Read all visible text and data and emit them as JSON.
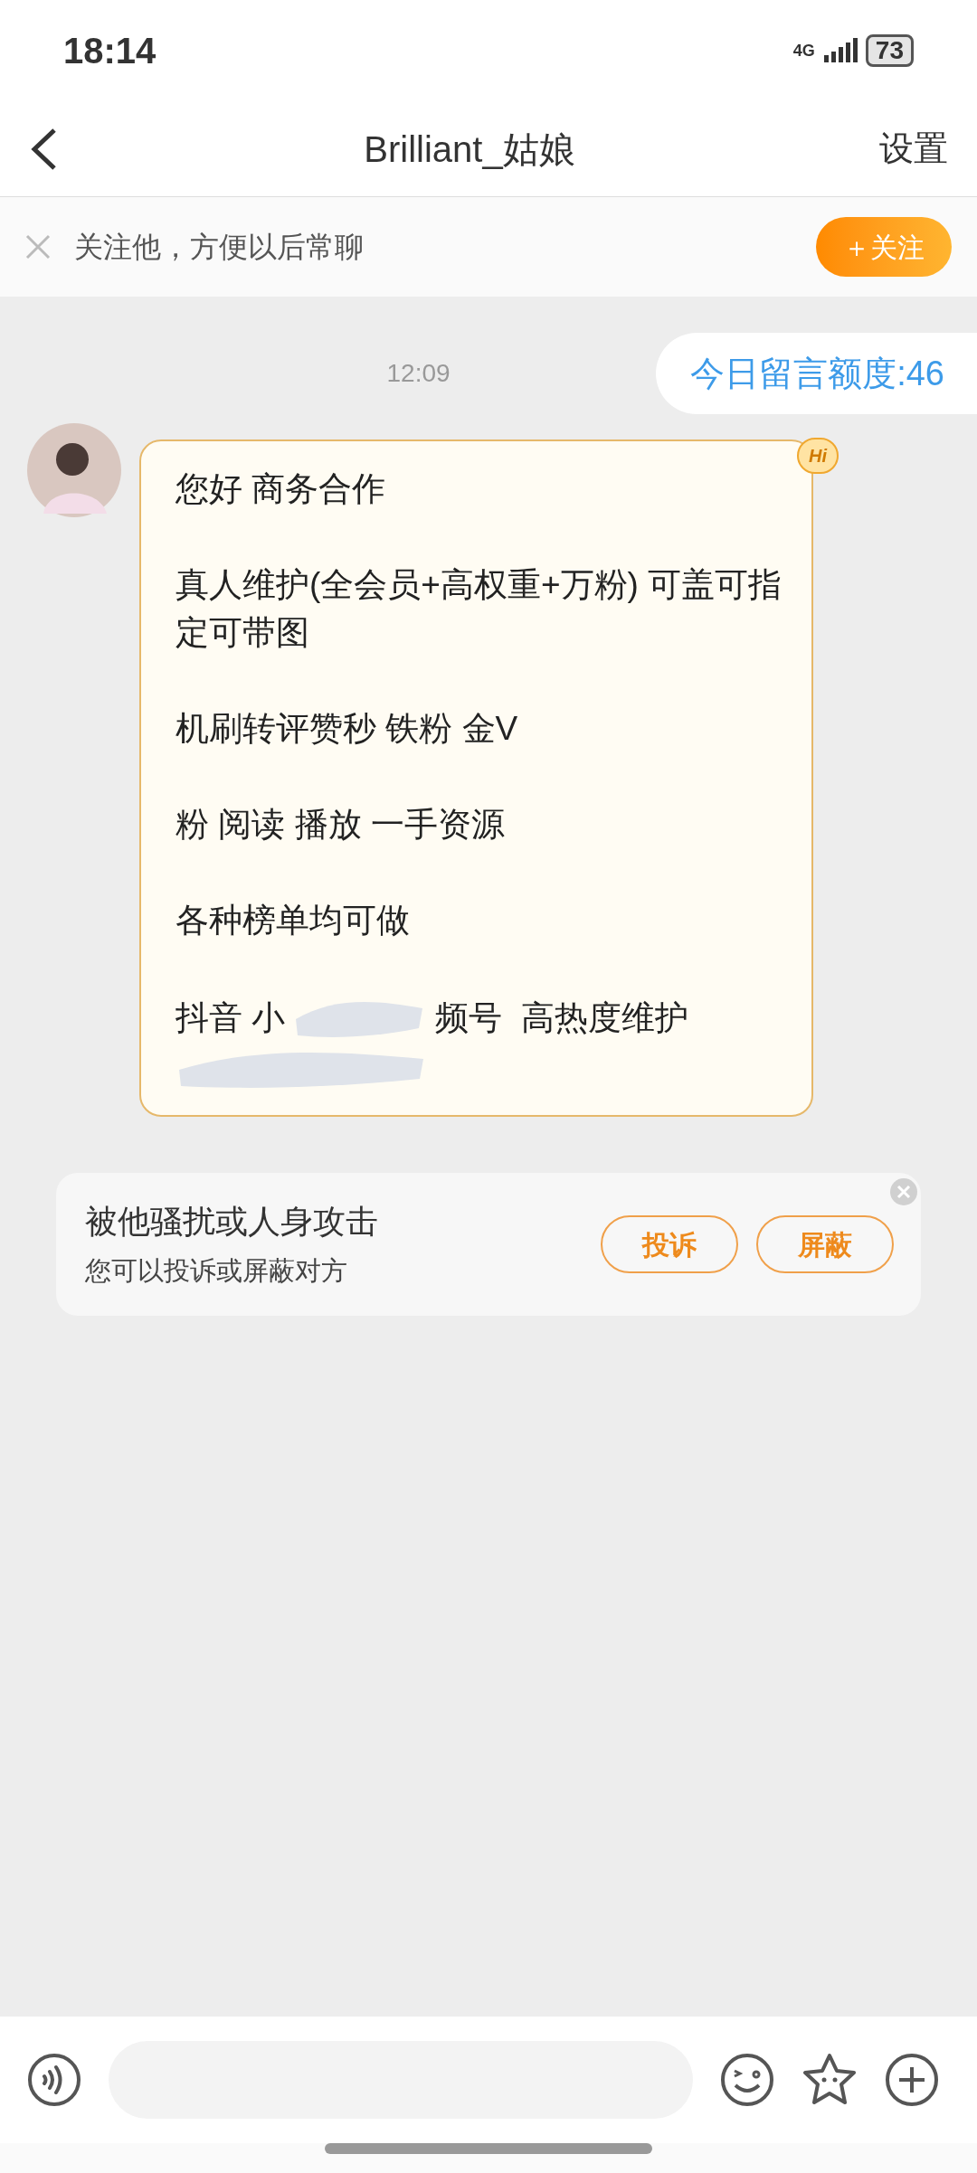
{
  "status_bar": {
    "time": "18:14",
    "network": "4G",
    "battery": "73"
  },
  "header": {
    "title": "Brilliant_姑娘",
    "action": "设置"
  },
  "follow_bar": {
    "text": "关注他，方便以后常聊",
    "button": "＋关注"
  },
  "chat": {
    "timestamp": "12:09",
    "quota": "今日留言额度:46",
    "message": {
      "badge": "Hi",
      "paragraphs": [
        {
          "kind": "text",
          "text": "您好 商务合作"
        },
        {
          "kind": "text",
          "text": "真人维护(全会员+高权重+万粉) 可盖可指定可带图"
        },
        {
          "kind": "text",
          "text": "机刷转评赞秒 铁粉 金V"
        },
        {
          "kind": "text",
          "text": "粉 阅读 播放 一手资源"
        },
        {
          "kind": "text",
          "text": "各种榜单均可做"
        },
        {
          "kind": "redacted",
          "before": "抖音 小",
          "after": "频号  高热度维护"
        }
      ]
    }
  },
  "safety_card": {
    "title": "被他骚扰或人身攻击",
    "subtitle": "您可以投诉或屏蔽对方",
    "buttons": [
      "投诉",
      "屏蔽"
    ]
  }
}
